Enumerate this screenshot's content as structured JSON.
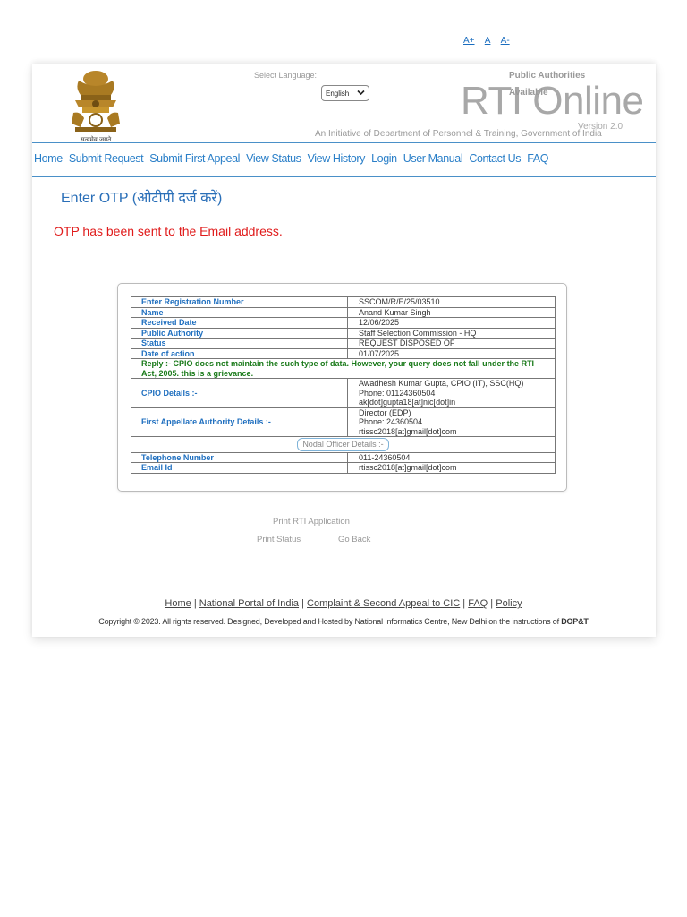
{
  "font_controls": {
    "increase": "A+",
    "normal": "A",
    "decrease": "A-"
  },
  "header": {
    "emblem_caption": "सत्यमेव जयते",
    "select_language_label": "Select Language:",
    "language_selected": "English",
    "public_authorities": "Public Authorities",
    "available": "Available",
    "site_title": "RTI Online",
    "version": "Version 2.0",
    "initiative": "An Initiative of Department of Personnel & Training, Government of India"
  },
  "nav": {
    "items": [
      "Home",
      "Submit Request",
      "Submit First Appeal",
      "View Status",
      "View History",
      "Login",
      "User Manual",
      "Contact Us",
      "FAQ"
    ]
  },
  "otp": {
    "heading": "Enter OTP (ओटीपी दर्ज करें)",
    "message": "OTP has been sent to the Email address."
  },
  "details": {
    "registration_label": "Enter Registration Number",
    "registration_value": "SSCOM/R/E/25/03510",
    "name_label": "Name",
    "name_value": "Anand Kumar Singh",
    "received_label": "Received Date",
    "received_value": "12/06/2025",
    "authority_label": "Public Authority",
    "authority_value": "Staff Selection Commission - HQ",
    "status_label": "Status",
    "status_value": "REQUEST DISPOSED OF",
    "action_label": "Date of action",
    "action_value": "01/07/2025",
    "reply": "Reply :- CPIO does not maintain the such type of data. However, your query does not fall under the RTI Act, 2005. this is a grievance.",
    "cpio_label": "CPIO Details :-",
    "cpio_line1": "Awadhesh Kumar Gupta, CPIO (IT), SSC(HQ)",
    "cpio_line2": "Phone: 01124360504",
    "cpio_line3": "ak[dot]gupta18[at]nic[dot]in",
    "faa_label": "First Appellate Authority Details :-",
    "faa_line1": "Director (EDP)",
    "faa_line2": "Phone: 24360504",
    "faa_line3": "rtissc2018[at]gmail[dot]com",
    "nodal_label": "Nodal Officer Details :-",
    "telephone_label": "Telephone Number",
    "telephone_value": "011-24360504",
    "email_label": "Email Id",
    "email_value": "rtissc2018[at]gmail[dot]com"
  },
  "actions": {
    "print_application": "Print RTI Application",
    "print_status": "Print Status",
    "go_back": "Go Back"
  },
  "footer": {
    "links": [
      "Home",
      "National Portal of India",
      "Complaint & Second Appeal to CIC",
      "FAQ",
      "Policy"
    ],
    "copyright": "Copyright © 2023. All rights reserved. Designed, Developed and Hosted by National Informatics Centre, New Delhi on the instructions of",
    "copyright_org": "DOP&T"
  }
}
